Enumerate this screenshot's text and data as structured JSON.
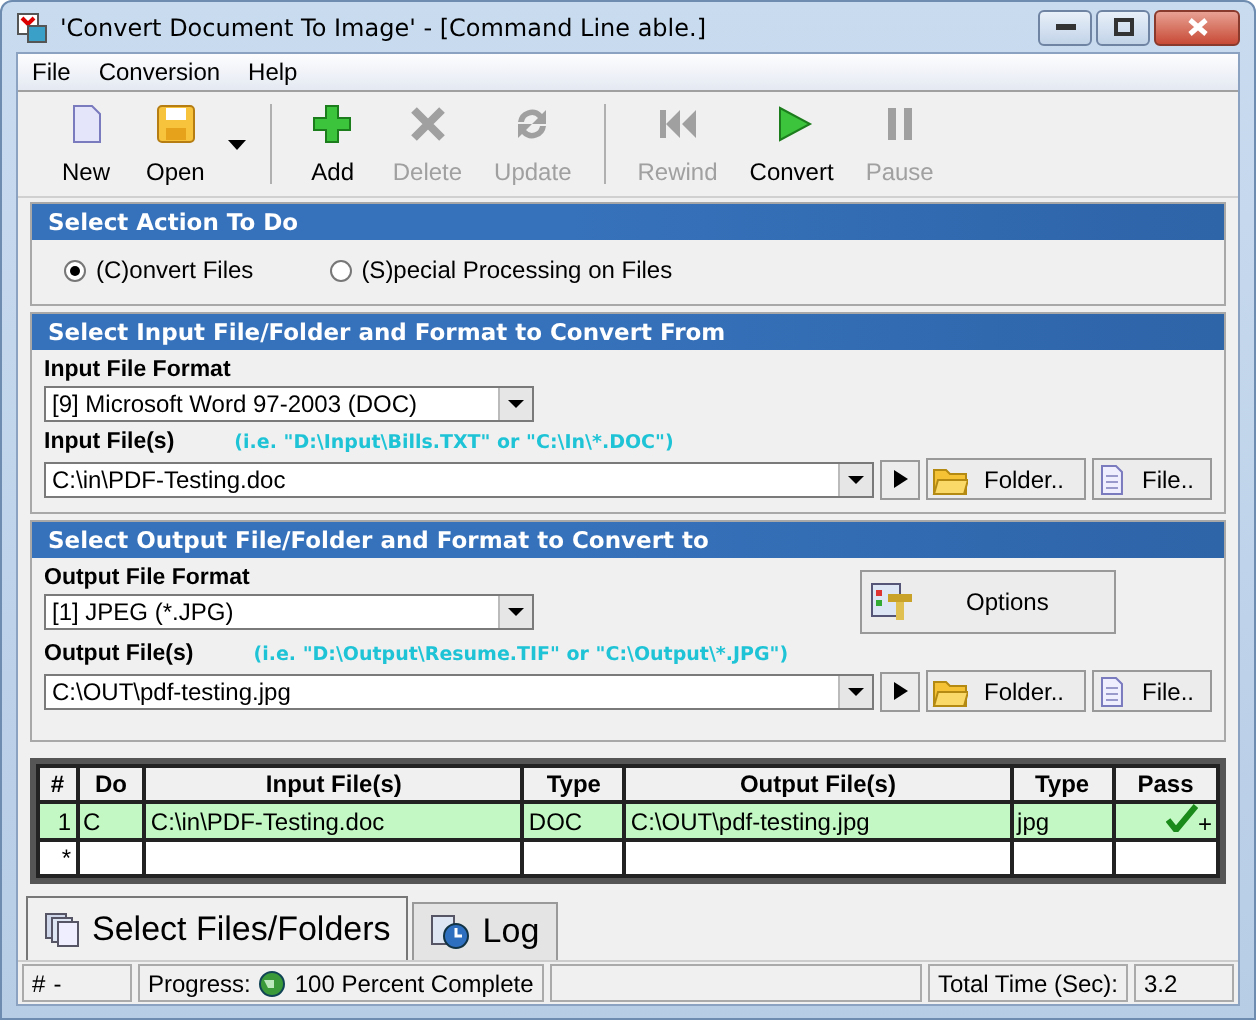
{
  "window": {
    "title": "'Convert Document To Image' - [Command Line able.]"
  },
  "menu": [
    {
      "label": "File"
    },
    {
      "label": "Conversion"
    },
    {
      "label": "Help"
    }
  ],
  "toolbar": [
    {
      "label": "New",
      "disabled": false
    },
    {
      "label": "Open",
      "disabled": false
    },
    {
      "label": "Add",
      "disabled": false
    },
    {
      "label": "Delete",
      "disabled": true
    },
    {
      "label": "Update",
      "disabled": true
    },
    {
      "label": "Rewind",
      "disabled": true
    },
    {
      "label": "Convert",
      "disabled": false
    },
    {
      "label": "Pause",
      "disabled": true
    }
  ],
  "action": {
    "title": "Select Action To Do",
    "options": [
      {
        "label": "(C)onvert Files",
        "selected": true
      },
      {
        "label": "(S)pecial Processing on Files",
        "selected": false
      }
    ]
  },
  "input": {
    "title": "Select Input File/Folder and Format to Convert From",
    "format_label": "Input File Format",
    "format_value": "[9] Microsoft Word 97-2003 (DOC)",
    "files_label": "Input File(s)",
    "files_hint": "(i.e. \"D:\\Input\\Bills.TXT\"  or \"C:\\In\\*.DOC\")",
    "files_value": "C:\\in\\PDF-Testing.doc",
    "folder_button": "Folder..",
    "file_button": "File.."
  },
  "output": {
    "title": "Select Output File/Folder and Format to Convert to",
    "format_label": "Output File Format",
    "format_value": "[1] JPEG (*.JPG)",
    "options_button": "Options",
    "files_label": "Output File(s)",
    "files_hint": "(i.e. \"D:\\Output\\Resume.TIF\" or \"C:\\Output\\*.JPG\")",
    "files_value": "C:\\OUT\\pdf-testing.jpg",
    "folder_button": "Folder..",
    "file_button": "File.."
  },
  "table": {
    "columns": [
      "#",
      "Do",
      "Input File(s)",
      "Type",
      "Output File(s)",
      "Type",
      "Pass"
    ],
    "rows": [
      {
        "cells": [
          "1",
          "C",
          "C:\\in\\PDF-Testing.doc",
          "DOC",
          "C:\\OUT\\pdf-testing.jpg",
          "jpg"
        ],
        "passed": true,
        "pass_mark": "+"
      },
      {
        "cells": [
          "*",
          "",
          "",
          "",
          "",
          ""
        ],
        "passed": false,
        "pass_mark": ""
      }
    ]
  },
  "tabs": [
    {
      "label": "Select Files/Folders",
      "selected": true
    },
    {
      "label": "Log",
      "selected": false
    }
  ],
  "status_bar": {
    "number_label": "#",
    "number_value": "-",
    "progress_label": "Progress:",
    "progress_text": "100 Percent Complete",
    "time_label": "Total Time (Sec):",
    "time_value": "3.2"
  }
}
